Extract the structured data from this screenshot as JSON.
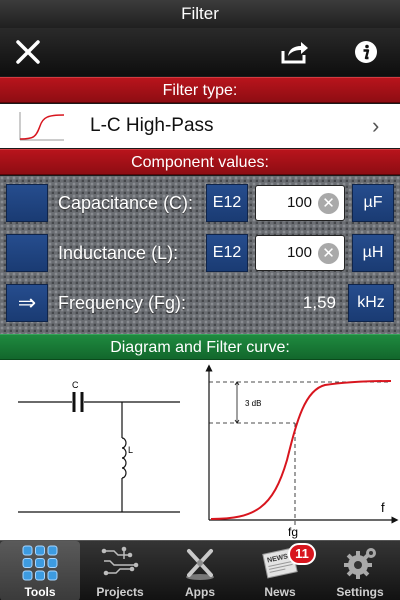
{
  "header": {
    "title": "Filter"
  },
  "sections": {
    "filter_type": "Filter type:",
    "component_values": "Component values:",
    "diagram": "Diagram and Filter curve:"
  },
  "filter": {
    "selected": "L-C High-Pass"
  },
  "components": {
    "capacitance": {
      "label": "Capacitance (C):",
      "series": "E12",
      "value": "100",
      "unit": "µF"
    },
    "inductance": {
      "label": "Inductance (L):",
      "series": "E12",
      "value": "100",
      "unit": "µH"
    },
    "frequency": {
      "label": "Frequency (Fg):",
      "value": "1,59",
      "unit": "kHz"
    }
  },
  "diagram": {
    "cap_label": "C",
    "ind_label": "L",
    "db_label": "3 dB",
    "x_axis": "f",
    "fg_label": "fg"
  },
  "tabs": [
    {
      "label": "Tools"
    },
    {
      "label": "Projects"
    },
    {
      "label": "Apps"
    },
    {
      "label": "News"
    },
    {
      "label": "Settings"
    }
  ],
  "news_badge": "11",
  "colors": {
    "section_red": "#a8111a",
    "section_green": "#188040",
    "blue": "#22478a",
    "curve": "#d8151e"
  }
}
